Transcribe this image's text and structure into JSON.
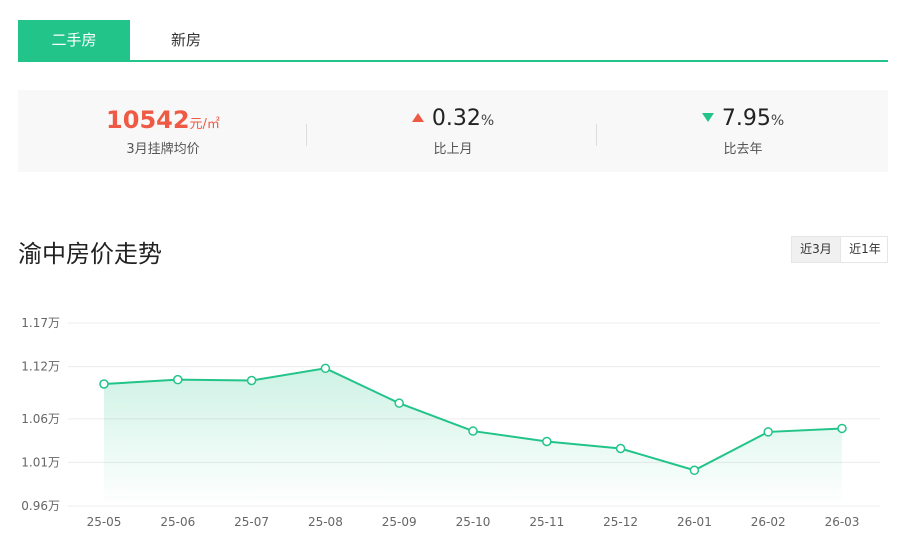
{
  "tabs": {
    "active": "二手房",
    "inactive": "新房"
  },
  "stats": {
    "avg_price": {
      "value": "10542",
      "unit": "元/㎡",
      "label": "3月挂牌均价"
    },
    "mom": {
      "value": "0.32",
      "unit": "%",
      "label": "比上月",
      "direction": "up"
    },
    "yoy": {
      "value": "7.95",
      "unit": "%",
      "label": "比去年",
      "direction": "down"
    }
  },
  "chart_title": "渝中房价走势",
  "range": {
    "active": "近3月",
    "inactive": "近1年"
  },
  "colors": {
    "accent": "#22c48a",
    "up": "#ee5a44",
    "down": "#22c48a"
  },
  "chart_data": {
    "type": "area",
    "categories": [
      "25-05",
      "25-06",
      "25-07",
      "25-08",
      "25-09",
      "25-10",
      "25-11",
      "25-12",
      "26-01",
      "26-02",
      "26-03"
    ],
    "values": [
      1.1,
      1.105,
      1.104,
      1.118,
      1.078,
      1.046,
      1.034,
      1.026,
      1.001,
      1.045,
      1.049
    ],
    "y_ticks": [
      0.96,
      1.01,
      1.06,
      1.12,
      1.17
    ],
    "y_tick_labels": [
      "0.96万",
      "1.01万",
      "1.06万",
      "1.12万",
      "1.17万"
    ],
    "ylim": [
      0.96,
      1.17
    ],
    "grid": true
  }
}
